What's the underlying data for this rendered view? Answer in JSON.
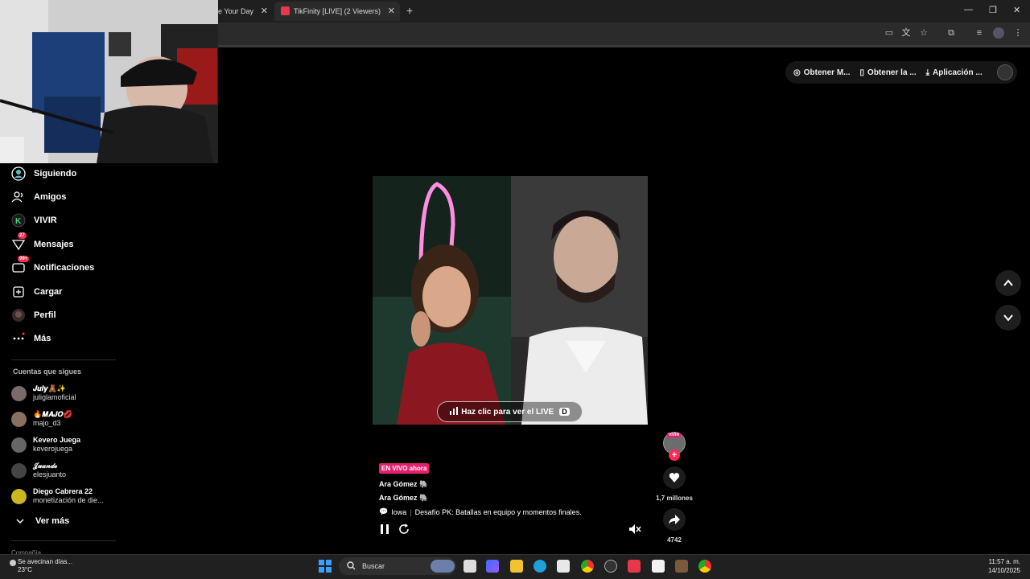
{
  "browser": {
    "tabs": [
      {
        "label": "e Your Day",
        "active": false
      },
      {
        "label": "TikFinity [LIVE] (2 Viewers)",
        "active": true
      }
    ],
    "new_tab": "+",
    "window_controls": {
      "minimize": "—",
      "restore": "❐",
      "close": "✕"
    }
  },
  "header": {
    "actions": [
      {
        "label": "Obtener M...",
        "icon": "coin-icon"
      },
      {
        "label": "Obtener la ...",
        "icon": "phone-icon"
      },
      {
        "label": "Aplicación ...",
        "icon": "download-icon"
      }
    ]
  },
  "sidebar": {
    "items": [
      {
        "label": "Siguiendo",
        "icon": "following-icon"
      },
      {
        "label": "Amigos",
        "icon": "friends-icon"
      },
      {
        "label": "VIVIR",
        "icon": "live-icon"
      },
      {
        "label": "Mensajes",
        "icon": "messages-icon",
        "badge": "27"
      },
      {
        "label": "Notificaciones",
        "icon": "notifications-icon",
        "badge": "99+"
      },
      {
        "label": "Cargar",
        "icon": "upload-icon"
      },
      {
        "label": "Perfil",
        "icon": "profile-icon"
      },
      {
        "label": "Más",
        "icon": "more-icon"
      }
    ],
    "following_title": "Cuentas que sigues",
    "accounts": [
      {
        "display": "𝑱𝒖𝒍𝒚🧸✨",
        "handle": "juliglamoficial"
      },
      {
        "display": "🔥𝑴𝑨𝑱𝑶💋",
        "handle": "majo_d3"
      },
      {
        "display": "Kevero Juega",
        "handle": "keverojuega"
      },
      {
        "display": "𝒥𝓊𝒶𝓃𝒹ℴ",
        "handle": "elesjuanto"
      },
      {
        "display": "Diego Cabrera 22",
        "handle": "monetización de die..."
      }
    ],
    "see_more": "Ver más",
    "cutoff_text": "Compañía"
  },
  "video": {
    "cta_label": "Haz clic para ver el LIVE",
    "cta_key": "D",
    "live_badge": "EN VIVO ahora",
    "host1": "Ara Gómez 🐘",
    "host2": "Ara Gómez 🐘",
    "location": "Iowa",
    "description": "Desafío PK: Batallas en equipo y momentos finales."
  },
  "right_rail": {
    "live_tag": "VIVIR",
    "likes": "1,7 millones",
    "shares": "4742"
  },
  "taskbar": {
    "weather_text": "Se avecinan días...",
    "weather_temp": "23°C",
    "search_placeholder": "Buscar",
    "time": "11:57 a. m.",
    "date": "14/10/2025"
  },
  "colors": {
    "accent": "#fe2c55",
    "live": "#e4206e",
    "background": "#000000"
  }
}
